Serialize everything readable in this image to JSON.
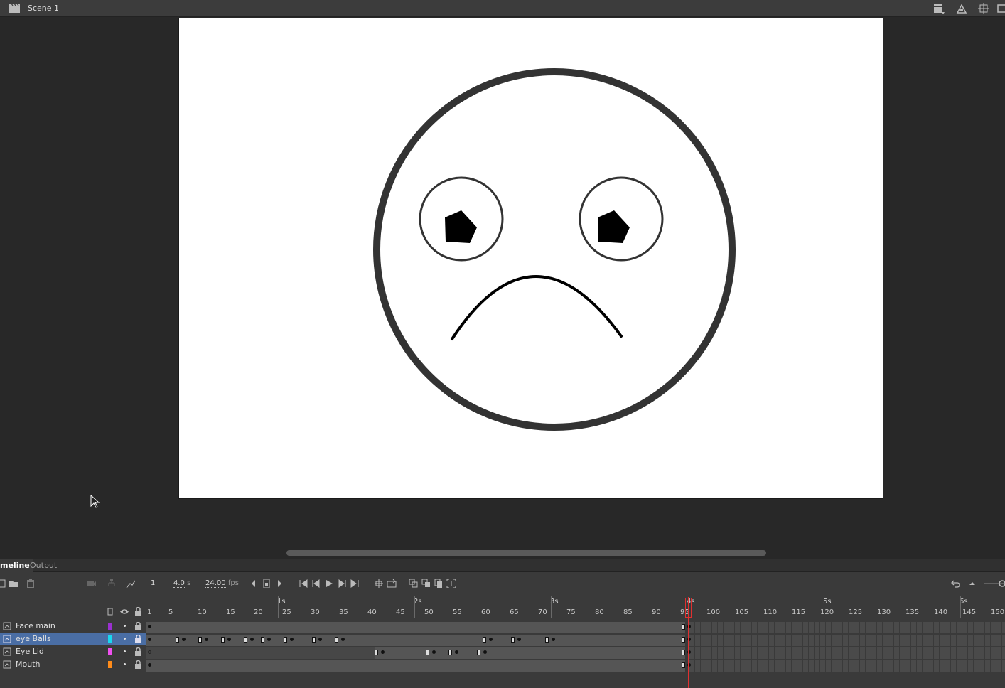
{
  "scene": {
    "title": "Scene 1"
  },
  "tabs": [
    {
      "label": "meline"
    },
    {
      "label": "Output"
    }
  ],
  "toolbar": {
    "current_frame": "1",
    "elapsed": "4.0",
    "elapsed_unit": "s",
    "fps": "24.00",
    "fps_unit": "fps"
  },
  "ruler": {
    "seconds": [
      "1s",
      "2s",
      "3s",
      "4s",
      "5s",
      "6s"
    ],
    "frames": [
      "1",
      "5",
      "10",
      "15",
      "20",
      "25",
      "30",
      "35",
      "40",
      "45",
      "50",
      "55",
      "60",
      "65",
      "70",
      "75",
      "80",
      "85",
      "90",
      "95",
      "100",
      "105",
      "110",
      "115",
      "120",
      "125",
      "130",
      "135",
      "140",
      "145",
      "150"
    ]
  },
  "layers": [
    {
      "name": "Face main",
      "color": "#9b30d0",
      "selected": false
    },
    {
      "name": "eye Balls",
      "color": "#19d8f0",
      "selected": true
    },
    {
      "name": "Eye Lid",
      "color": "#f050f0",
      "selected": false
    },
    {
      "name": "Mouth",
      "color": "#ff8c1a",
      "selected": false
    }
  ],
  "colors": {
    "accent": "#4a6ea5",
    "playhead": "#e03030",
    "stage": "#ffffff"
  }
}
